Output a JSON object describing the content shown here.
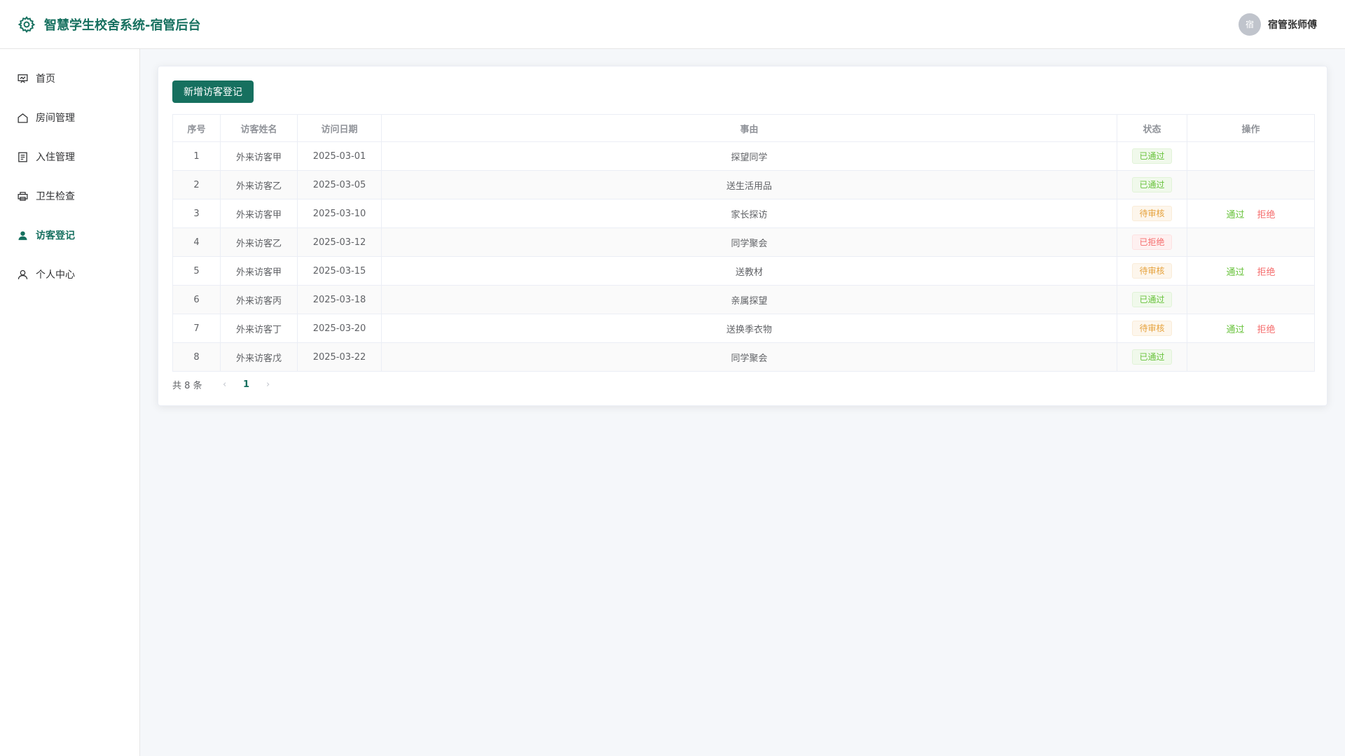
{
  "header": {
    "title": "智慧学生校舍系统-宿管后台",
    "avatar_text": "宿",
    "user_name": "宿管张师傅"
  },
  "sidebar": {
    "items": [
      {
        "label": "首页",
        "icon": "home-chart-icon"
      },
      {
        "label": "房间管理",
        "icon": "house-icon"
      },
      {
        "label": "入住管理",
        "icon": "document-icon"
      },
      {
        "label": "卫生检查",
        "icon": "printer-icon"
      },
      {
        "label": "访客登记",
        "icon": "user-filled-icon",
        "active": true
      },
      {
        "label": "个人中心",
        "icon": "user-icon"
      }
    ]
  },
  "toolbar": {
    "add_label": "新增访客登记"
  },
  "table": {
    "headers": [
      "序号",
      "访客姓名",
      "访问日期",
      "事由",
      "状态",
      "操作"
    ],
    "rows": [
      {
        "no": "1",
        "name": "外来访客甲",
        "date": "2025-03-01",
        "reason": "探望同学",
        "status": "已通过",
        "status_type": "success",
        "actions": []
      },
      {
        "no": "2",
        "name": "外来访客乙",
        "date": "2025-03-05",
        "reason": "送生活用品",
        "status": "已通过",
        "status_type": "success",
        "actions": []
      },
      {
        "no": "3",
        "name": "外来访客甲",
        "date": "2025-03-10",
        "reason": "家长探访",
        "status": "待审核",
        "status_type": "warning",
        "actions": [
          "通过",
          "拒绝"
        ]
      },
      {
        "no": "4",
        "name": "外来访客乙",
        "date": "2025-03-12",
        "reason": "同学聚会",
        "status": "已拒绝",
        "status_type": "danger",
        "actions": []
      },
      {
        "no": "5",
        "name": "外来访客甲",
        "date": "2025-03-15",
        "reason": "送教材",
        "status": "待审核",
        "status_type": "warning",
        "actions": [
          "通过",
          "拒绝"
        ]
      },
      {
        "no": "6",
        "name": "外来访客丙",
        "date": "2025-03-18",
        "reason": "亲属探望",
        "status": "已通过",
        "status_type": "success",
        "actions": []
      },
      {
        "no": "7",
        "name": "外来访客丁",
        "date": "2025-03-20",
        "reason": "送换季衣物",
        "status": "待审核",
        "status_type": "warning",
        "actions": [
          "通过",
          "拒绝"
        ]
      },
      {
        "no": "8",
        "name": "外来访客戊",
        "date": "2025-03-22",
        "reason": "同学聚会",
        "status": "已通过",
        "status_type": "success",
        "actions": []
      }
    ]
  },
  "pagination": {
    "total_label": "共 8 条",
    "prev": "‹",
    "current": "1",
    "next": "›"
  },
  "colors": {
    "brand": "#16705f",
    "success": "#67c23a",
    "warning": "#e6a23c",
    "danger": "#f56c6c"
  }
}
